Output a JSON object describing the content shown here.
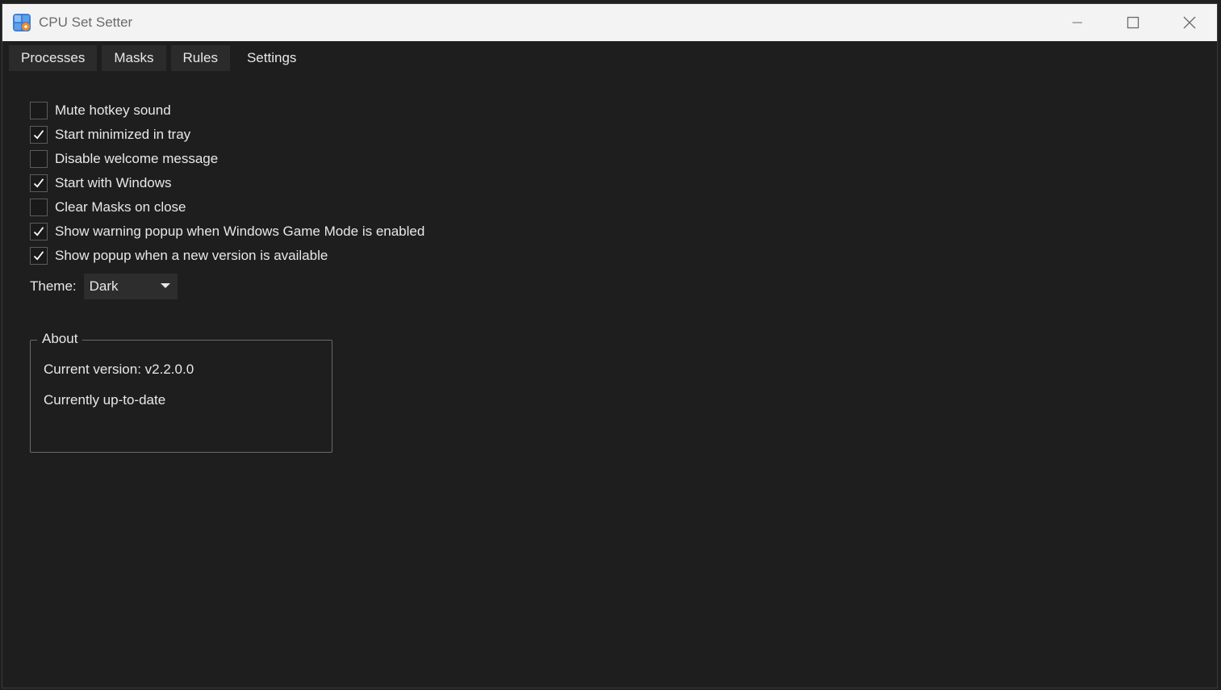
{
  "window": {
    "title": "CPU Set Setter",
    "icon": "app-icon",
    "controls": {
      "minimize_icon": "minimize-icon",
      "maximize_icon": "maximize-icon",
      "close_icon": "close-icon"
    }
  },
  "tabs": [
    {
      "label": "Processes",
      "active": false
    },
    {
      "label": "Masks",
      "active": false
    },
    {
      "label": "Rules",
      "active": false
    },
    {
      "label": "Settings",
      "active": true
    }
  ],
  "settings": {
    "options": [
      {
        "label": "Mute hotkey sound",
        "checked": false
      },
      {
        "label": "Start minimized in tray",
        "checked": true
      },
      {
        "label": "Disable welcome message",
        "checked": false
      },
      {
        "label": "Start with Windows",
        "checked": true
      },
      {
        "label": "Clear Masks on close",
        "checked": false
      },
      {
        "label": "Show warning popup when Windows Game Mode is enabled",
        "checked": true
      },
      {
        "label": "Show popup when a new version is available",
        "checked": true
      }
    ],
    "theme": {
      "label": "Theme:",
      "value": "Dark"
    }
  },
  "about": {
    "title": "About",
    "current_version": "Current version: v2.2.0.0",
    "status": "Currently up-to-date"
  },
  "colors": {
    "window_bg": "#1e1e1e",
    "titlebar_bg": "#f3f3f3",
    "tab_bg": "#2b2b2b",
    "text": "#e8e8e8"
  }
}
